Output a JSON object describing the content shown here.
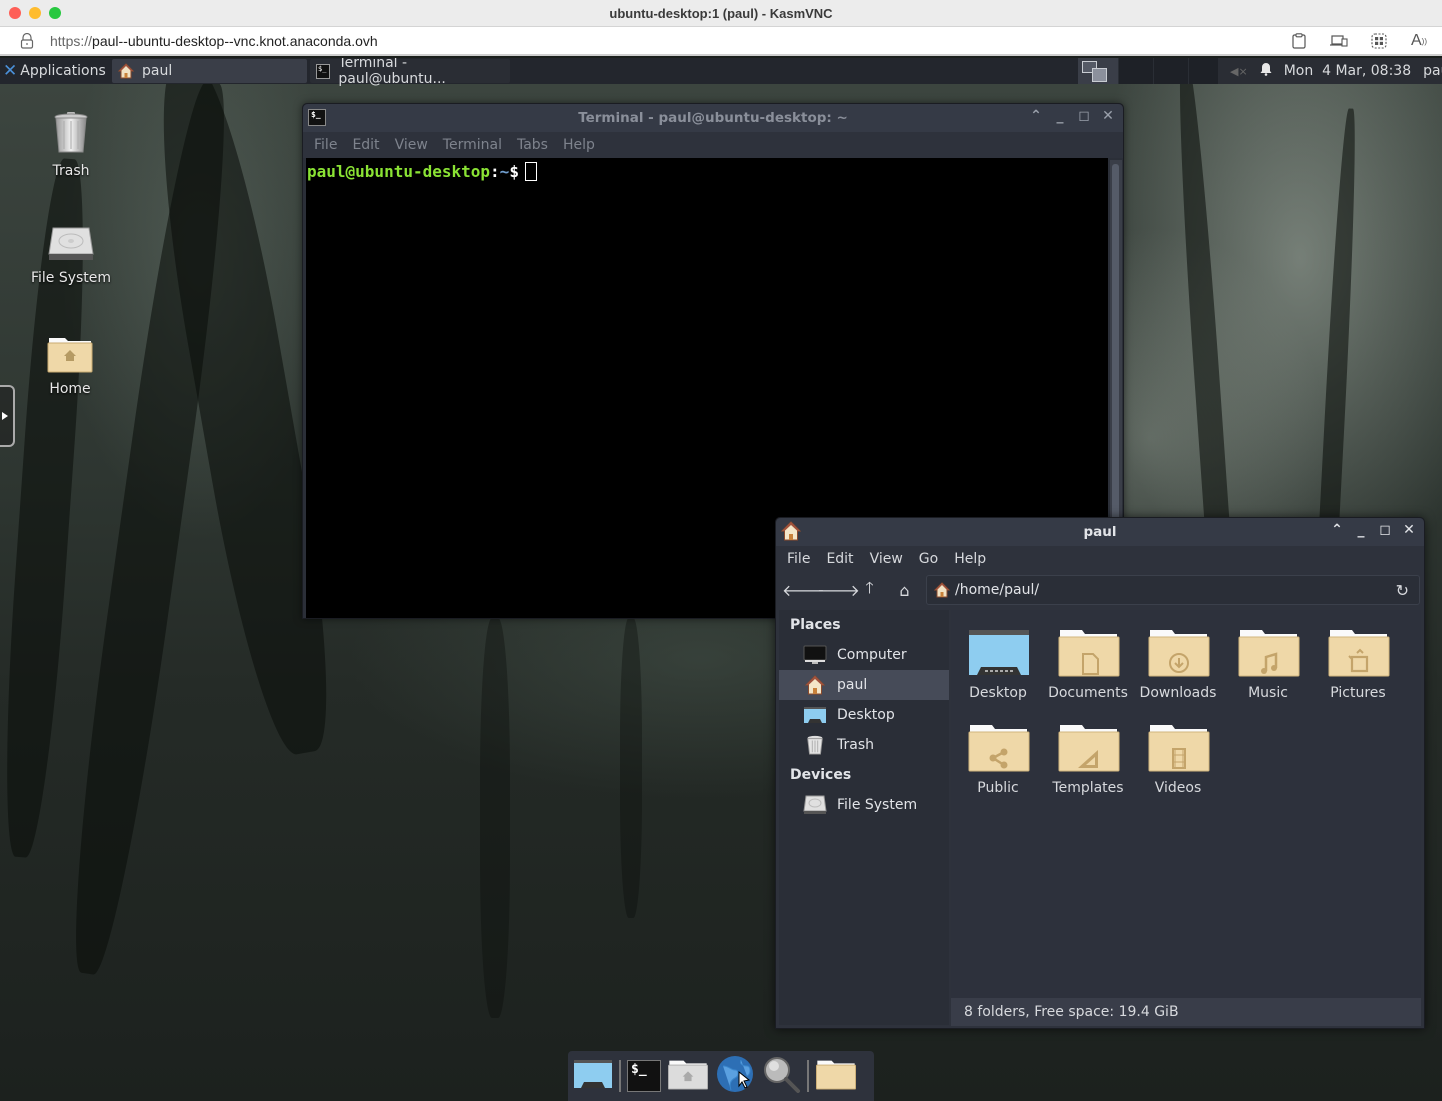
{
  "browser": {
    "window_title": "ubuntu-desktop:1 (paul) - KasmVNC",
    "url_protocol": "https://",
    "url_host": "paul--ubuntu-desktop--vnc.knot.anaconda.ovh",
    "toolbar_icons": [
      "clipboard-icon",
      "devices-icon",
      "apps-icon",
      "read-aloud-icon"
    ]
  },
  "panel": {
    "applications_label": "Applications",
    "tasks": [
      {
        "label": "paul",
        "icon": "home-icon"
      },
      {
        "label": "Terminal - paul@ubuntu...",
        "icon": "terminal-icon"
      }
    ],
    "clock": "Mon  4 Mar, 08:38",
    "user": "paul"
  },
  "desktop_icons": [
    {
      "label": "Trash",
      "icon": "trash-icon"
    },
    {
      "label": "File System",
      "icon": "drive-icon"
    },
    {
      "label": "Home",
      "icon": "home-folder-icon"
    }
  ],
  "terminal": {
    "title": "Terminal - paul@ubuntu-desktop: ~",
    "menu": [
      "File",
      "Edit",
      "View",
      "Terminal",
      "Tabs",
      "Help"
    ],
    "prompt_user": "paul@ubuntu-desktop",
    "prompt_sep": ":",
    "prompt_path": "~",
    "prompt_symbol": "$",
    "colors": {
      "user": "#8ae234",
      "path": "#729fcf"
    }
  },
  "file_manager": {
    "title": "paul",
    "menu": [
      "File",
      "Edit",
      "View",
      "Go",
      "Help"
    ],
    "location": "/home/paul/",
    "sidebar": {
      "places_label": "Places",
      "places": [
        {
          "label": "Computer",
          "icon": "computer-icon"
        },
        {
          "label": "paul",
          "icon": "home-icon",
          "selected": true
        },
        {
          "label": "Desktop",
          "icon": "desktop-icon"
        },
        {
          "label": "Trash",
          "icon": "trash-icon"
        }
      ],
      "devices_label": "Devices",
      "devices": [
        {
          "label": "File System",
          "icon": "drive-icon"
        }
      ]
    },
    "folders": [
      {
        "label": "Desktop",
        "emblem": "desktop"
      },
      {
        "label": "Documents",
        "emblem": "document"
      },
      {
        "label": "Downloads",
        "emblem": "download"
      },
      {
        "label": "Music",
        "emblem": "music"
      },
      {
        "label": "Pictures",
        "emblem": "picture"
      },
      {
        "label": "Public",
        "emblem": "share"
      },
      {
        "label": "Templates",
        "emblem": "template"
      },
      {
        "label": "Videos",
        "emblem": "video"
      }
    ],
    "status": "8 folders, Free space: 19.4 GiB"
  },
  "dock": [
    "show-desktop-icon",
    "terminal-icon",
    "home-folder-icon",
    "web-browser-icon",
    "search-icon",
    "folder-icon"
  ]
}
